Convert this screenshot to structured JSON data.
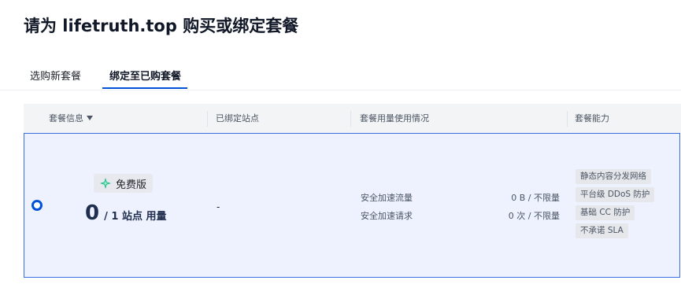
{
  "page": {
    "title": "请为 lifetruth.top 购买或绑定套餐"
  },
  "tabs": [
    {
      "label": "选购新套餐",
      "active": false
    },
    {
      "label": "绑定至已购套餐",
      "active": true
    }
  ],
  "table": {
    "headers": {
      "plan_info": "套餐信息",
      "bound_sites": "已绑定站点",
      "usage": "套餐用量使用情况",
      "capabilities": "套餐能力"
    },
    "row": {
      "selected": true,
      "plan_badge": "免费版",
      "used": "0",
      "quota_text": "/ 1 站点 用量",
      "bound_sites": "-",
      "metrics": [
        {
          "label": "安全加速流量",
          "value": "0 B / 不限量"
        },
        {
          "label": "安全加速请求",
          "value": "0 次 / 不限量"
        }
      ],
      "capabilities": [
        "静态内容分发网络",
        "平台级 DDoS 防护",
        "基础 CC 防护",
        "不承诺 SLA"
      ]
    }
  },
  "colors": {
    "accent": "#0052d9",
    "selected_row_bg": "#eef2ff",
    "selected_row_border": "#3b6fe3",
    "header_bg": "#f3f4f6",
    "badge_icon": "#10b981"
  },
  "icons": {
    "filter": "filter-icon",
    "badge": "sparkle-icon",
    "radio": "radio-selected-icon"
  }
}
